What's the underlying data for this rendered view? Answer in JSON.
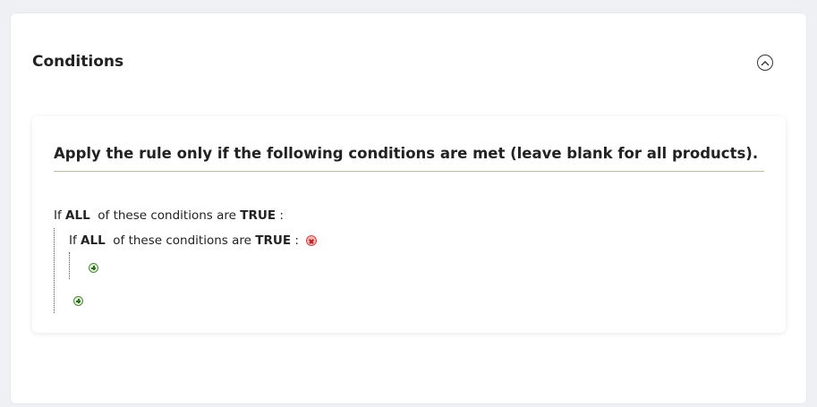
{
  "panel": {
    "title": "Conditions"
  },
  "rule": {
    "heading": "Apply the rule only if the following conditions are met (leave blank for all products).",
    "outer": {
      "prefix": "If",
      "aggregator": "ALL",
      "middle": "of these conditions are",
      "value": "TRUE",
      "suffix": ":"
    },
    "inner": {
      "prefix": "If",
      "aggregator": "ALL",
      "middle": "of these conditions are",
      "value": "TRUE",
      "suffix": ":"
    }
  },
  "icons": {
    "collapse": "chevron-up-icon",
    "add": "add-condition-icon",
    "remove": "remove-condition-icon"
  },
  "colors": {
    "add_green": "#4f8a3c",
    "remove_red": "#d24a4a",
    "heading_rule": "#b8bfa6"
  }
}
